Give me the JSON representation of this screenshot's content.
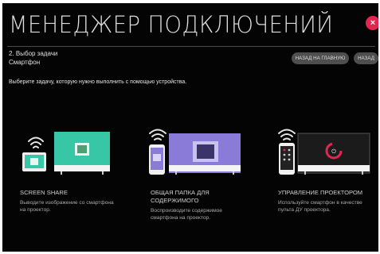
{
  "header": {
    "title": "МЕНЕДЖЕР ПОДКЛЮЧЕНИЙ",
    "step": "2. Выбор задачи",
    "device": "Смартфон",
    "close_label": "×"
  },
  "buttons": {
    "home": "НАЗАД НА ГЛАВНУЮ",
    "back": "НАЗАД"
  },
  "instruction": "Выберите задачу, которую нужно выполнить с помощью устройства.",
  "tasks": [
    {
      "title": "SCREEN SHARE",
      "description": "Выводите изображение со смартфона на проектор.",
      "icon": "screen-share-icon"
    },
    {
      "title": "ОБЩАЯ ПАПКА ДЛЯ СОДЕРЖИМОГО",
      "description": "Воспроизводите содержимое смартфона на проектор.",
      "icon": "shared-folder-icon"
    },
    {
      "title": "УПРАВЛЕНИЕ ПРОЕКТОРОМ",
      "description": "Используйте смартфон в качестве пульта ДУ проектора.",
      "icon": "projector-control-icon"
    }
  ],
  "colors": {
    "background": "#040404",
    "close": "#e3264f",
    "button": "#4e4e4e",
    "screen_share_teal": "#37c7a6",
    "shared_folder_purple": "#8b7bd8",
    "control_red": "#e3264f"
  }
}
